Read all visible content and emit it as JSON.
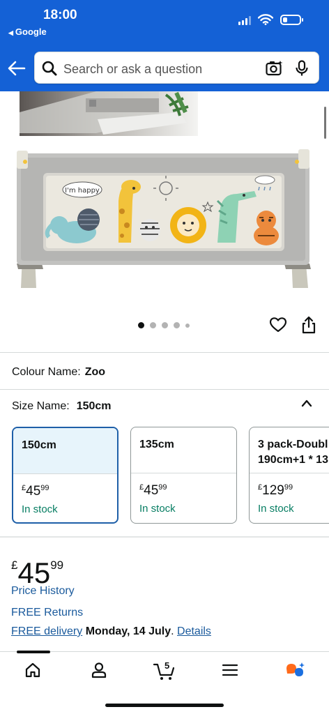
{
  "status_bar": {
    "time": "18:00",
    "back_app": "Google"
  },
  "search": {
    "placeholder": "Search or ask a question"
  },
  "gallery": {
    "image_text": "I'm happy",
    "dot_count": 5,
    "active_dot": 1
  },
  "colour": {
    "label": "Colour Name:",
    "value": "Zoo"
  },
  "size": {
    "label": "Size Name:",
    "value": "150cm",
    "options": [
      {
        "name": "150cm",
        "price_currency": "£",
        "price_pounds": "45",
        "price_pence": "99",
        "stock": "In stock",
        "selected": true
      },
      {
        "name": "135cm",
        "price_currency": "£",
        "price_pounds": "45",
        "price_pence": "99",
        "stock": "In stock",
        "selected": false
      },
      {
        "name": "3 pack-Doubl 190cm+1 * 13",
        "name_line1": "3 pack-Doubl",
        "name_line2": "190cm+1 * 13",
        "price_currency": "£",
        "price_pounds": "129",
        "price_pence": "99",
        "stock": "In stock",
        "selected": false
      }
    ]
  },
  "price": {
    "currency": "£",
    "pounds": "45",
    "pence": "99",
    "history_link": "Price History",
    "returns_link": "FREE Returns",
    "delivery_link": "FREE delivery",
    "delivery_date": "Monday, 14 July",
    "delivery_sep": ".",
    "details_link": "Details"
  },
  "bottom_nav": {
    "cart_count": "5",
    "items": [
      "home-icon",
      "account-icon",
      "cart-icon",
      "menu-icon",
      "rufus-assistant-icon"
    ]
  },
  "colors": {
    "header_blue": "#1461d6",
    "link_blue": "#1a5a9c",
    "stock_green": "#067d62",
    "selected_border": "#1e5fa8",
    "selected_bg": "#e7f4fb"
  }
}
